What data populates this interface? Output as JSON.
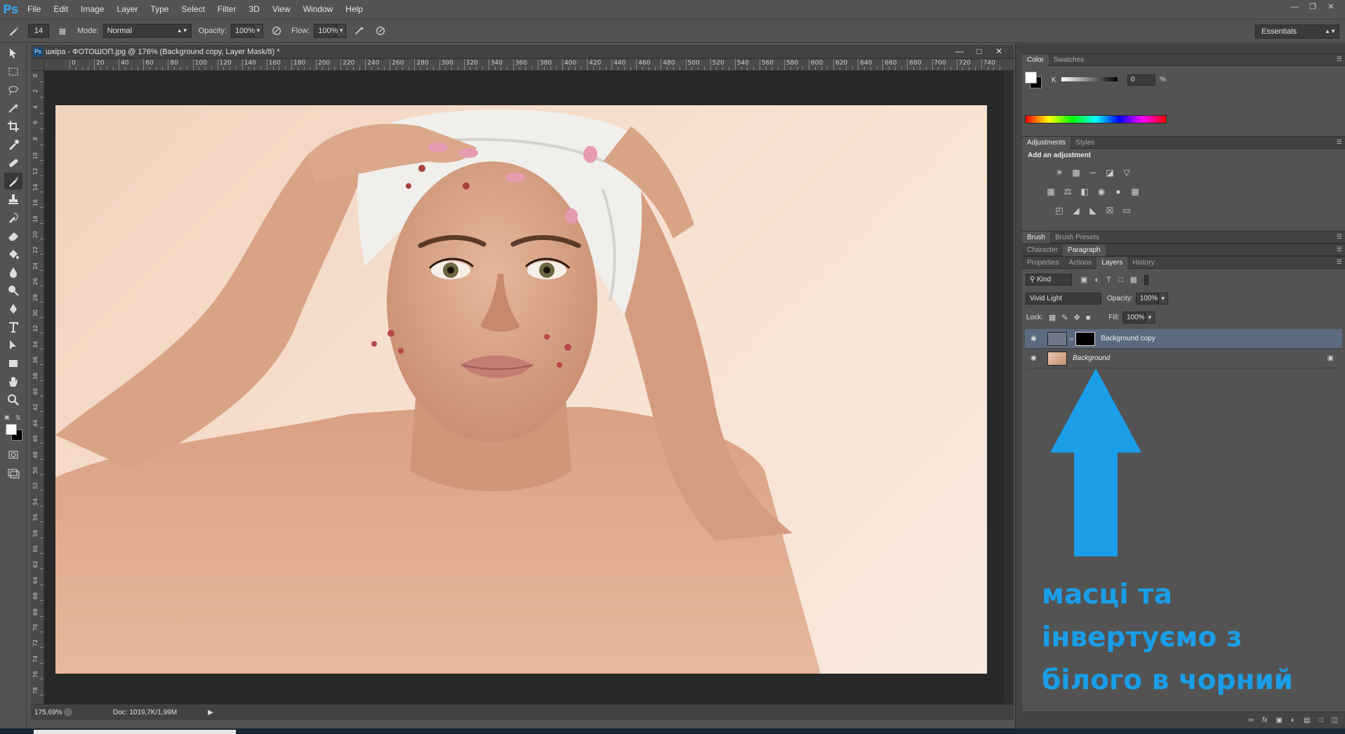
{
  "app": {
    "logo": "Ps"
  },
  "menu": [
    "File",
    "Edit",
    "Image",
    "Layer",
    "Type",
    "Select",
    "Filter",
    "3D",
    "View",
    "Window",
    "Help"
  ],
  "options_bar": {
    "brush_size": "14",
    "mode_label": "Mode:",
    "mode_value": "Normal",
    "opacity_label": "Opacity:",
    "opacity_value": "100%",
    "flow_label": "Flow:",
    "flow_value": "100%",
    "workspace": "Essentials"
  },
  "document": {
    "tab_icon": "Ps",
    "title": "шкіра - ФОТОШОП.jpg @ 176% (Background copy, Layer Mask/8) *",
    "zoom": "175,69%",
    "doc_info": "Doc: 1019,7K/1,99M",
    "ruler_h": [
      "0",
      "20",
      "40",
      "60",
      "80",
      "100",
      "120",
      "140",
      "160",
      "180",
      "200",
      "220",
      "240",
      "260",
      "280",
      "300",
      "320",
      "340",
      "360",
      "380",
      "400",
      "420",
      "440",
      "460",
      "480",
      "500",
      "520",
      "540",
      "560",
      "580",
      "600",
      "620",
      "640",
      "660",
      "680",
      "700",
      "720",
      "740"
    ],
    "ruler_v": [
      "0",
      "2",
      "4",
      "6",
      "8",
      "10",
      "12",
      "14",
      "16",
      "18",
      "20",
      "22",
      "24",
      "26",
      "28",
      "30",
      "32",
      "34",
      "36",
      "38",
      "40",
      "42",
      "44",
      "46",
      "48",
      "50",
      "52",
      "54",
      "56",
      "58",
      "60",
      "62",
      "64",
      "66",
      "68",
      "70",
      "72",
      "74",
      "76",
      "78"
    ]
  },
  "panels": {
    "color": {
      "tabs": [
        "Color",
        "Swatches"
      ],
      "k_label": "K",
      "k_value": "0",
      "k_unit": "%"
    },
    "adjustments": {
      "tabs": [
        "Adjustments",
        "Styles"
      ],
      "title": "Add an adjustment"
    },
    "brush": {
      "tabs": [
        "Brush",
        "Brush Presets"
      ]
    },
    "character": {
      "tabs": [
        "Character",
        "Paragraph"
      ]
    },
    "layers": {
      "tabs": [
        "Properties",
        "Actions",
        "Layers",
        "History"
      ],
      "kind_filter": "Kind",
      "blend_mode": "Vivid Light",
      "opacity_label": "Opacity:",
      "opacity_value": "100%",
      "lock_label": "Lock:",
      "fill_label": "Fill:",
      "fill_value": "100%",
      "items": [
        {
          "name": "Background copy",
          "selected": true
        },
        {
          "name": "Background",
          "selected": false
        }
      ],
      "footer_icons": [
        "link-icon",
        "fx-icon",
        "mask-icon",
        "adjustment-icon",
        "group-icon",
        "new-layer-icon",
        "trash-icon"
      ]
    }
  },
  "annotation": {
    "lines": [
      "масці та",
      "інвертуємо з",
      "білого в чорний"
    ],
    "color": "#1a9ee8"
  }
}
